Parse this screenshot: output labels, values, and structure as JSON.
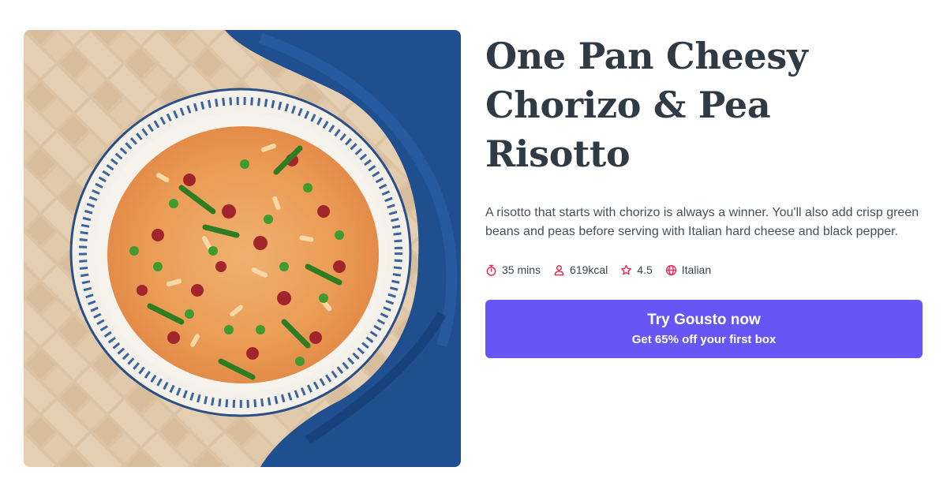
{
  "recipe": {
    "title_line1": "One Pan Cheesy",
    "title_line2": "Chorizo & Pea Risotto",
    "description": "A risotto that starts with chorizo is always a winner. You'll also add crisp green beans and peas before serving with Italian hard cheese and black pepper.",
    "meta": {
      "time": "35 mins",
      "calories": "619kcal",
      "rating": "4.5",
      "cuisine": "Italian"
    },
    "meta_icons": [
      "stopwatch-icon",
      "person-icon",
      "star-icon",
      "globe-icon"
    ]
  },
  "cta": {
    "main_label": "Try Gousto now",
    "sub_label": "Get 65% off your first box"
  },
  "colors": {
    "accent": "#6656f5",
    "icon": "#e8224d",
    "title": "#2f3a45"
  }
}
